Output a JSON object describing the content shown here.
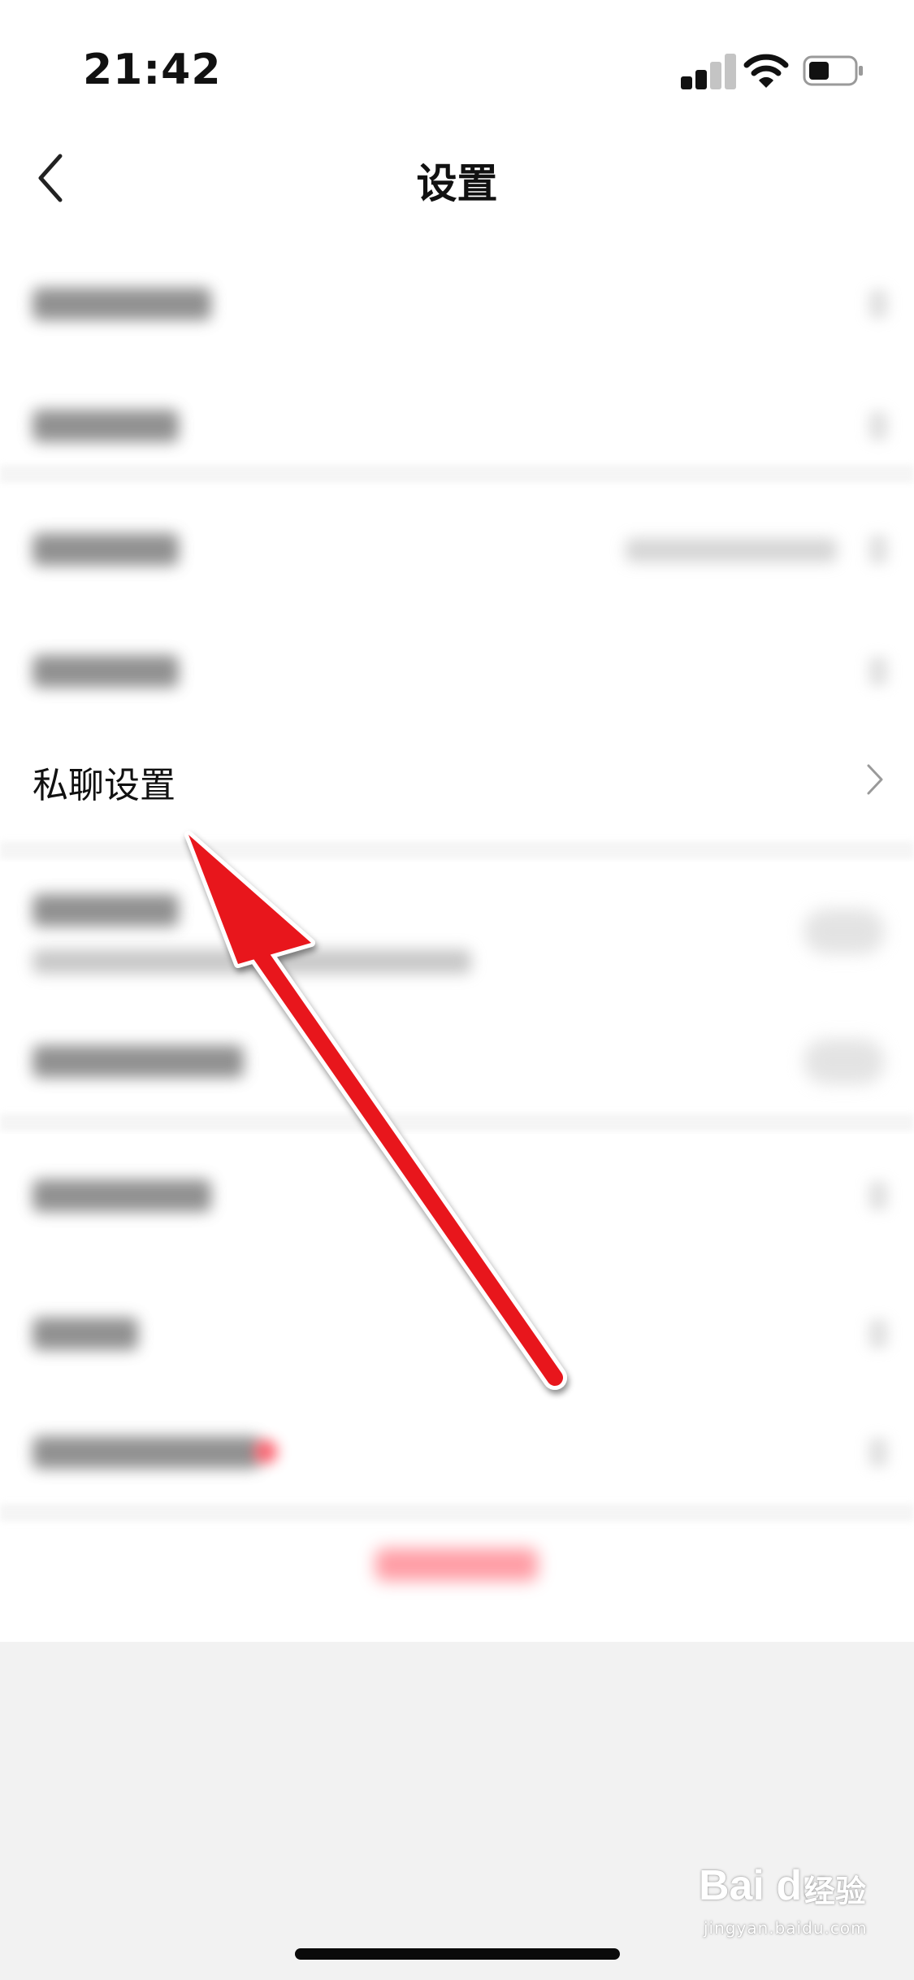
{
  "status_bar": {
    "time": "21:42",
    "icons": [
      "signal-icon",
      "wifi-icon",
      "battery-icon"
    ]
  },
  "nav": {
    "title": "设置",
    "back_icon": "chevron-left-icon"
  },
  "settings": {
    "private_chat_label": "私聊设置",
    "chevron_icon": "chevron-right-icon"
  },
  "annotation": {
    "color": "#e8141e"
  },
  "watermark": {
    "brand": "Bai du",
    "cn": "经验",
    "url": "jingyan.baidu.com"
  },
  "colors": {
    "background": "#f2f2f2",
    "surface": "#ffffff",
    "text": "#111111",
    "accent_red": "#ff3344"
  }
}
